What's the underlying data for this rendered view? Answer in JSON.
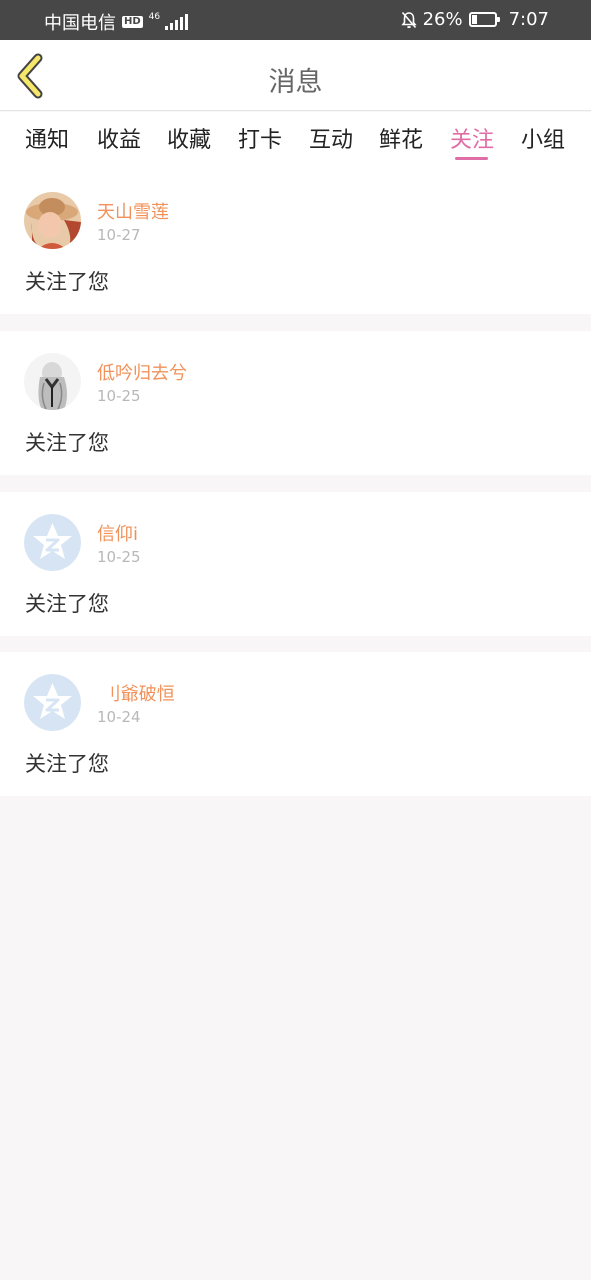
{
  "status_bar": {
    "carrier": "中国电信",
    "hd": "HD",
    "network": "46",
    "battery_percent": "26%",
    "battery_level": 0.26,
    "time": "7:07"
  },
  "header": {
    "title": "消息",
    "back_icon": "chevron-left-icon"
  },
  "tabs": [
    {
      "label": "通知"
    },
    {
      "label": "收益"
    },
    {
      "label": "收藏"
    },
    {
      "label": "打卡"
    },
    {
      "label": "互动"
    },
    {
      "label": "鲜花"
    },
    {
      "label": "关注"
    },
    {
      "label": "小组"
    }
  ],
  "active_tab": "关注",
  "colors": {
    "accent": "#e06ea6",
    "username": "#f0925a",
    "status_bar": "#474747",
    "page_bg": "#f8f6f7"
  },
  "messages": [
    {
      "username": "天山雪莲",
      "date": "10-27",
      "text": "关注了您",
      "avatar": "photo-avatar"
    },
    {
      "username": "低吟归去兮",
      "date": "10-25",
      "text": "关注了您",
      "avatar": "sketch-avatar"
    },
    {
      "username": "信仰i",
      "date": "10-25",
      "text": "关注了您",
      "avatar": "qq-default-avatar"
    },
    {
      "username": " 刂爺破恒",
      "date": "10-24",
      "text": "关注了您",
      "avatar": "qq-default-avatar"
    }
  ]
}
